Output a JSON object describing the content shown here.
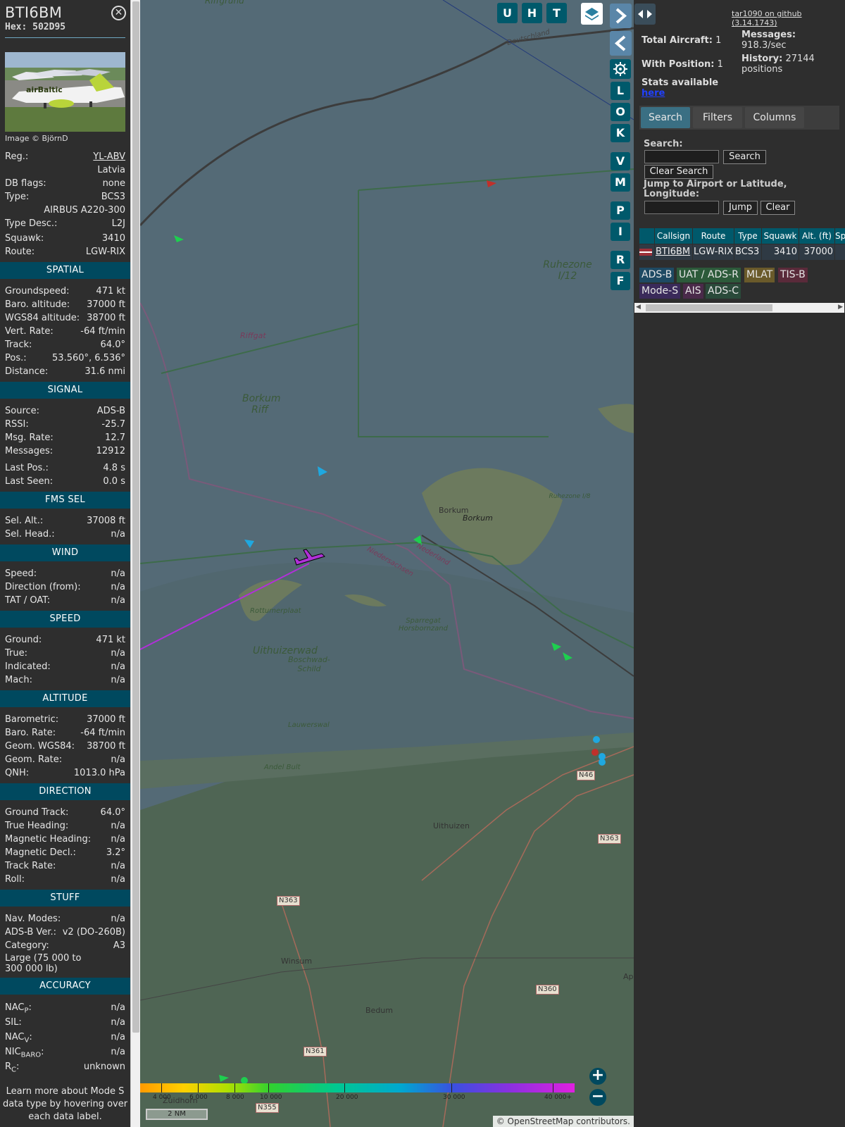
{
  "aircraft": {
    "callsign": "BTI6BM",
    "hex_label": "Hex:",
    "hex": "502D95",
    "image_credit": "Image © BjörnD",
    "photo_text": "airBaltic"
  },
  "details": [
    {
      "label": "Reg.:",
      "value": "YL-ABV",
      "link": true
    },
    {
      "label": "",
      "value": "Latvia"
    },
    {
      "label": "DB flags:",
      "value": "none"
    },
    {
      "label": "Type:",
      "value": "BCS3"
    },
    {
      "label": "",
      "value": "AIRBUS A220-300"
    },
    {
      "label": "Type Desc.:",
      "value": "L2J"
    },
    {
      "label": "Squawk:",
      "value": "3410"
    },
    {
      "label": "Route:",
      "value": "LGW-RIX"
    }
  ],
  "sections": {
    "spatial": {
      "title": "SPATIAL",
      "rows": [
        {
          "label": "Groundspeed:",
          "value": "471 kt"
        },
        {
          "label": "Baro. altitude:",
          "value": "37000 ft"
        },
        {
          "label": "WGS84 altitude:",
          "value": "38700 ft"
        },
        {
          "label": "Vert. Rate:",
          "value": "-64 ft/min"
        },
        {
          "label": "Track:",
          "value": "64.0°"
        },
        {
          "label": "Pos.:",
          "value": "53.560°, 6.536°"
        },
        {
          "label": "Distance:",
          "value": "31.6 nmi"
        }
      ]
    },
    "signal": {
      "title": "SIGNAL",
      "rows": [
        {
          "label": "Source:",
          "value": "ADS-B"
        },
        {
          "label": "RSSI:",
          "value": "-25.7"
        },
        {
          "label": "Msg. Rate:",
          "value": "12.7"
        },
        {
          "label": "Messages:",
          "value": "12912"
        },
        {
          "label": "Last Pos.:",
          "value": "4.8 s"
        },
        {
          "label": "Last Seen:",
          "value": "0.0 s"
        }
      ]
    },
    "fms": {
      "title": "FMS SEL",
      "rows": [
        {
          "label": "Sel. Alt.:",
          "value": "37008 ft"
        },
        {
          "label": "Sel. Head.:",
          "value": "n/a"
        }
      ]
    },
    "wind": {
      "title": "WIND",
      "rows": [
        {
          "label": "Speed:",
          "value": "n/a"
        },
        {
          "label": "Direction (from):",
          "value": "n/a"
        },
        {
          "label": "TAT / OAT:",
          "value": "n/a"
        }
      ]
    },
    "speed": {
      "title": "SPEED",
      "rows": [
        {
          "label": "Ground:",
          "value": "471 kt"
        },
        {
          "label": "True:",
          "value": "n/a"
        },
        {
          "label": "Indicated:",
          "value": "n/a"
        },
        {
          "label": "Mach:",
          "value": "n/a"
        }
      ]
    },
    "altitude": {
      "title": "ALTITUDE",
      "rows": [
        {
          "label": "Barometric:",
          "value": "37000 ft"
        },
        {
          "label": "Baro. Rate:",
          "value": "-64 ft/min"
        },
        {
          "label": "Geom. WGS84:",
          "value": "38700 ft"
        },
        {
          "label": "Geom. Rate:",
          "value": "n/a"
        },
        {
          "label": "QNH:",
          "value": "1013.0 hPa"
        }
      ]
    },
    "direction": {
      "title": "DIRECTION",
      "rows": [
        {
          "label": "Ground Track:",
          "value": "64.0°"
        },
        {
          "label": "True Heading:",
          "value": "n/a"
        },
        {
          "label": "Magnetic Heading:",
          "value": "n/a"
        },
        {
          "label": "Magnetic Decl.:",
          "value": "3.2°"
        },
        {
          "label": "Track Rate:",
          "value": "n/a"
        },
        {
          "label": "Roll:",
          "value": "n/a"
        }
      ]
    },
    "stuff": {
      "title": "STUFF",
      "rows": [
        {
          "label": "Nav. Modes:",
          "value": "n/a"
        },
        {
          "label": "ADS-B Ver.:",
          "value": "v2 (DO-260B)"
        },
        {
          "label": "Category:",
          "value": "A3"
        }
      ],
      "category_desc": "Large (75 000 to 300 000 lb)"
    },
    "accuracy": {
      "title": "ACCURACY",
      "rows": [
        {
          "label": "NAC",
          "sub": "P",
          "value": "n/a"
        },
        {
          "label": "SIL:",
          "sub": "",
          "value": "n/a"
        },
        {
          "label": "NAC",
          "sub": "V",
          "value": "n/a"
        },
        {
          "label": "NIC",
          "sub": "BARO",
          "value": "n/a"
        },
        {
          "label": "R",
          "sub": "C",
          "value": "unknown"
        }
      ]
    }
  },
  "footer_note": "Learn more about Mode S data type by hovering over each data label.",
  "map": {
    "top_buttons": [
      "U",
      "H",
      "T"
    ],
    "side_buttons": [
      "L",
      "O",
      "K",
      "V",
      "M",
      "P",
      "I",
      "R",
      "F"
    ],
    "labels": {
      "borkum_riff": "Borkum Riff",
      "ruhezone": "Ruhezone I/12",
      "riffgat": "Riffgat",
      "borkum1": "Borkum",
      "borkum2": "Borkum",
      "rottumerplaat": "Rottumerplaat",
      "uithuizerwad": "Uithuizerwad",
      "boschwad": "Boschwad-Schild",
      "sparregat": "Sparregat Horsbornzand",
      "lauwerswal": "Lauwerswal",
      "andel": "Andel Bult",
      "uithuizen": "Uithuizen",
      "winsum": "Winsum",
      "bedum": "Bedum",
      "deutschland": "Deutschland",
      "nederland": "Nederland",
      "niedersachsen": "Niedersachsen",
      "riffgrund": "Riffgrund",
      "ruhezone_small": "Ruhezone I/8",
      "zuidhorn": "Zuidhorn",
      "ap": "Ap"
    },
    "roads": [
      "N46",
      "N363",
      "N363",
      "N360",
      "N361",
      "N355"
    ],
    "altitude_scale": [
      "4 000",
      "6 000",
      "8 000",
      "10 000",
      "20 000",
      "30 000",
      "40 000+"
    ],
    "scale_bar": "2 NM",
    "attribution_prefix": "©",
    "attribution_link": "OpenStreetMap",
    "attribution_suffix": "contributors.",
    "zoom_in": "+",
    "zoom_out": "−"
  },
  "panel": {
    "github_link": "tar1090 on github (3.14.1743)",
    "total_aircraft_label": "Total Aircraft:",
    "total_aircraft": "1",
    "with_position_label": "With Position:",
    "with_position": "1",
    "messages_label": "Messages:",
    "messages_rate": "918.3/sec",
    "history_label": "History:",
    "history_value": "27144",
    "history_unit": "positions",
    "stats_label": "Stats available",
    "stats_link": "here",
    "tabs": [
      "Search",
      "Filters",
      "Columns"
    ],
    "search_label": "Search:",
    "search_button": "Search",
    "clear_search_button": "Clear Search",
    "jump_label": "Jump to Airport or Latitude, Longitude:",
    "jump_button": "Jump",
    "clear_button": "Clear",
    "table": {
      "headers": [
        "",
        "Callsign",
        "Route",
        "Type",
        "Squawk",
        "Alt. (ft)",
        "Sp"
      ],
      "row": {
        "callsign": "BTI6BM",
        "route": "LGW-RIX",
        "type": "BCS3",
        "squawk": "3410",
        "alt": "37000"
      }
    },
    "legend": [
      {
        "label": "ADS-B",
        "color": "#1e4a63"
      },
      {
        "label": "UAT / ADS-R",
        "color": "#2c5a3a"
      },
      {
        "label": "MLAT",
        "color": "#6a5a2a"
      },
      {
        "label": "TIS-B",
        "color": "#5a2a3a"
      },
      {
        "label": "Mode-S",
        "color": "#3a2a5a"
      },
      {
        "label": "AIS",
        "color": "#4a2a4a"
      },
      {
        "label": "ADS-C",
        "color": "#2a4a3a"
      }
    ]
  }
}
